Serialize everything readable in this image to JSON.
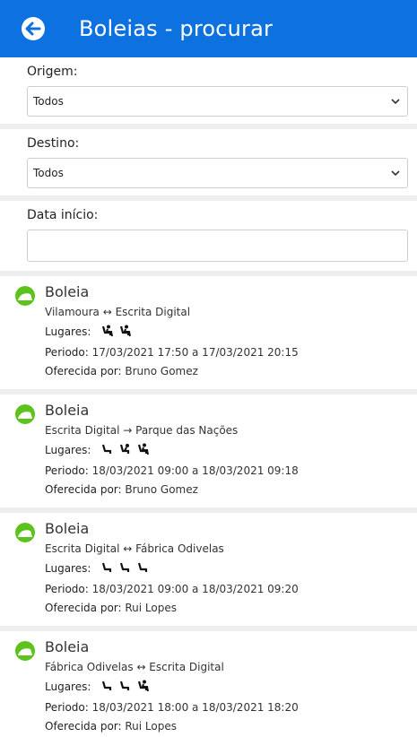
{
  "header": {
    "title": "Boleias - procurar"
  },
  "filters": {
    "origem": {
      "label": "Origem:",
      "value": "Todos"
    },
    "destino": {
      "label": "Destino:",
      "value": "Todos"
    },
    "data_inicio": {
      "label": "Data início:",
      "value": ""
    }
  },
  "rides": [
    {
      "title": "Boleia",
      "route": "Vilamoura ↔ Escrita Digital",
      "lugares_label": "Lugares:",
      "seats": [
        "occupied-seat",
        "occupied-seat"
      ],
      "periodo_label": "Periodo:",
      "periodo": "17/03/2021 17:50 a  17/03/2021 20:15",
      "oferecida_label": "Oferecida por:",
      "oferecida": "Bruno Gomez"
    },
    {
      "title": "Boleia",
      "route": "Escrita Digital → Parque das Nações",
      "lugares_label": "Lugares:",
      "seats": [
        "free-seat",
        "partial-seat",
        "occupied-seat"
      ],
      "periodo_label": "Periodo:",
      "periodo": "18/03/2021 09:00 a  18/03/2021 09:18",
      "oferecida_label": "Oferecida por:",
      "oferecida": "Bruno Gomez"
    },
    {
      "title": "Boleia",
      "route": "Escrita Digital ↔ Fábrica Odivelas",
      "lugares_label": "Lugares:",
      "seats": [
        "free-seat",
        "free-seat",
        "free-seat"
      ],
      "periodo_label": "Periodo:",
      "periodo": "18/03/2021 09:00 a  18/03/2021 09:20",
      "oferecida_label": "Oferecida por:",
      "oferecida": "Rui Lopes"
    },
    {
      "title": "Boleia",
      "route": "Fábrica Odivelas ↔ Escrita Digital",
      "lugares_label": "Lugares:",
      "seats": [
        "free-seat",
        "free-seat",
        "occupied-seat"
      ],
      "periodo_label": "Periodo:",
      "periodo": "18/03/2021 18:00 a  18/03/2021 18:20",
      "oferecida_label": "Oferecida por:",
      "oferecida": "Rui Lopes"
    }
  ],
  "colors": {
    "header": "#0d71e0",
    "ride_icon": "#5cc21c"
  }
}
